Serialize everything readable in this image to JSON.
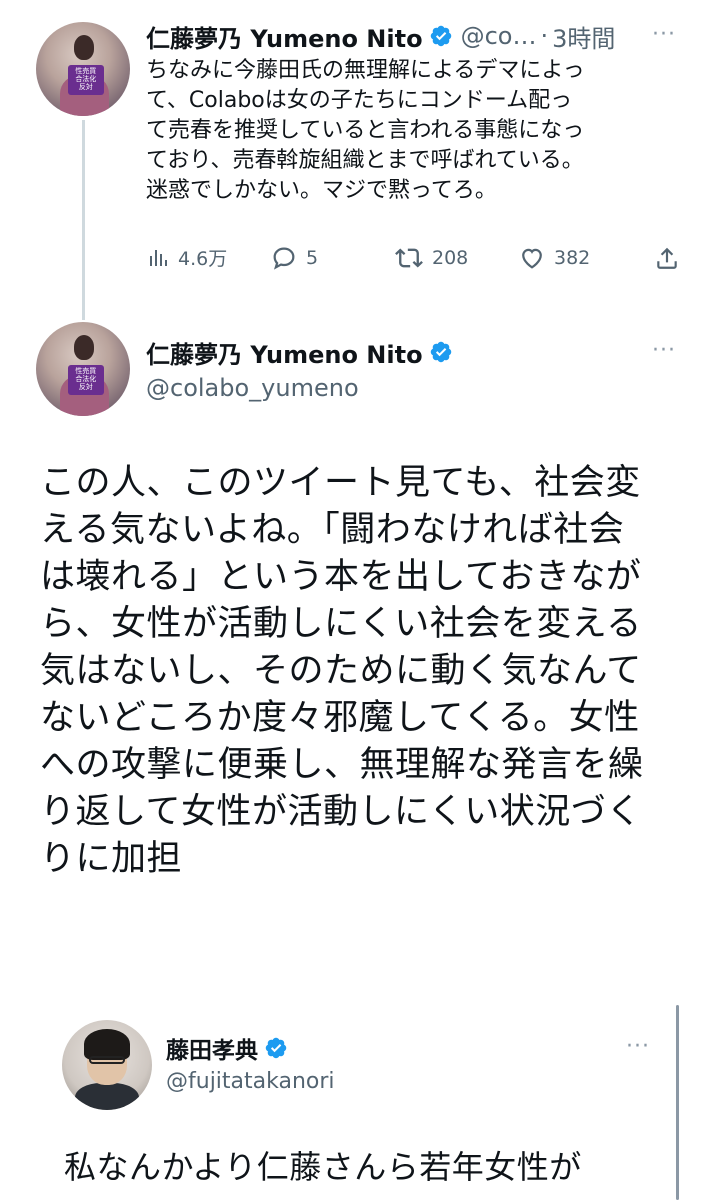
{
  "tweet1": {
    "name": "仁藤夢乃  Yumeno Nito",
    "handle": "@co…",
    "separator": "·",
    "time": "3時間",
    "more": "···",
    "avatar_sign": "性売買\n合法化\n反対",
    "text": "ちなみに今藤田氏の無理解によるデマによっ\nて、Colaboは女の子たちにコンドーム配っ\nて売春を推奨していると言われる事態になっ\nており、売春斡旋組織とまで呼ばれている。\n迷惑でしかない。マジで黙ってろ。",
    "stats": {
      "views": "4.6万",
      "replies": "5",
      "retweets": "208",
      "likes": "382"
    }
  },
  "tweet2": {
    "name": "仁藤夢乃  Yumeno Nito",
    "handle": "@colabo_yumeno",
    "more": "···",
    "avatar_sign": "性売買\n合法化\n反対",
    "text": "この人、このツイート見ても、社会変\nえる気ないよね。「闘わなければ社会\nは壊れる」という本を出しておきなが\nら、女性が活動しにくい社会を変える\n気はないし、そのために動く気なんて\nないどころか度々邪魔してくる。女性\nへの攻撃に便乗し、無理解な発言を繰\nり返して女性が活動しにくい状況づく\nりに加担"
  },
  "quoted": {
    "name": "藤田孝典",
    "handle": "@fujitatakanori",
    "more": "···",
    "text": "私なんかより仁藤さんら若年女性が"
  },
  "colors": {
    "verified": "#1d9bf0",
    "text": "#0f1419",
    "secondary": "#536471"
  }
}
